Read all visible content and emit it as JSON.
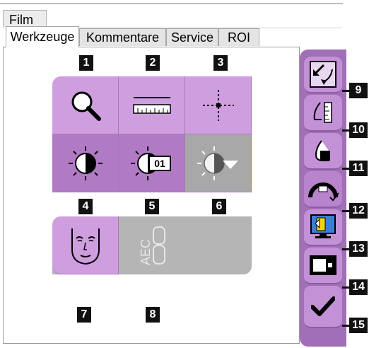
{
  "menu": {
    "film_label": "Film"
  },
  "tabs": [
    {
      "label": "Werkzeuge",
      "active": true
    },
    {
      "label": "Kommentare",
      "active": false
    },
    {
      "label": "Service",
      "active": false
    },
    {
      "label": "ROI",
      "active": false
    }
  ],
  "tools": [
    {
      "number": "1",
      "icon": "magnifier-icon"
    },
    {
      "number": "2",
      "icon": "ruler-icon"
    },
    {
      "number": "3",
      "icon": "crosshair-icon"
    },
    {
      "number": "4",
      "icon": "contrast-icon"
    },
    {
      "number": "5",
      "icon": "contrast-preset-icon",
      "icon_text": "01"
    },
    {
      "number": "6",
      "icon": "contrast-dropdown-icon",
      "disabled": true
    },
    {
      "number": "7",
      "icon": "face-icon"
    },
    {
      "number": "8",
      "icon": "aec-icon",
      "icon_text": "AEC",
      "disabled": true
    }
  ],
  "side_tools": [
    {
      "number": "9",
      "icon": "flip-arrows-icon"
    },
    {
      "number": "10",
      "icon": "breast-ruler-icon"
    },
    {
      "number": "11",
      "icon": "breast-implant-icon"
    },
    {
      "number": "12",
      "icon": "gauge-check-icon"
    },
    {
      "number": "13",
      "icon": "monitor-image-icon"
    },
    {
      "number": "14",
      "icon": "dots-icon"
    },
    {
      "number": "15",
      "icon": "checkmark-icon"
    }
  ],
  "colors": {
    "tool_bg": "#cf9edf",
    "tool_dark": "#b17ac4",
    "sidebar": "#a16fb6",
    "disabled": "#a8a8a8"
  }
}
